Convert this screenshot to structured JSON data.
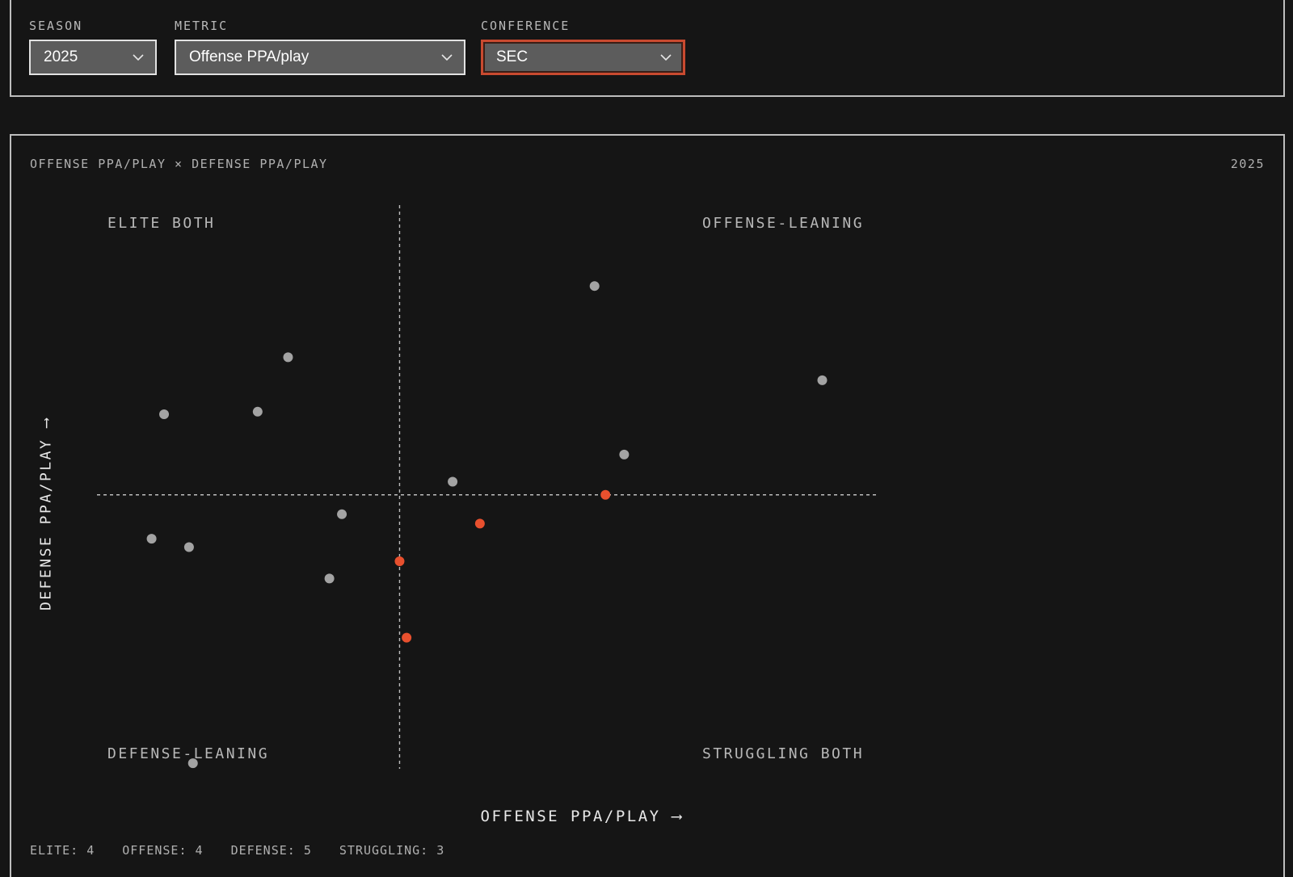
{
  "filters": {
    "season": {
      "label": "SEASON",
      "value": "2025"
    },
    "metric": {
      "label": "METRIC",
      "value": "Offense PPA/play"
    },
    "conference": {
      "label": "CONFERENCE",
      "value": "SEC"
    }
  },
  "chart": {
    "title": "OFFENSE PPA/PLAY × DEFENSE PPA/PLAY",
    "year": "2025",
    "quadrants": {
      "top_left": "ELITE BOTH",
      "top_right": "OFFENSE-LEANING",
      "bottom_left": "DEFENSE-LEANING",
      "bottom_right": "STRUGGLING BOTH"
    },
    "x_axis_label": "OFFENSE PPA/PLAY ⟶",
    "y_axis_label": "DEFENSE PPA/PLAY ⟶",
    "counts": {
      "elite": "ELITE: 4",
      "offense": "OFFENSE: 4",
      "defense": "DEFENSE: 5",
      "struggling": "STRUGGLING: 3"
    }
  },
  "chart_data": {
    "type": "scatter",
    "title": "OFFENSE PPA/PLAY × DEFENSE PPA/PLAY",
    "xlabel": "OFFENSE PPA/PLAY",
    "ylabel": "DEFENSE PPA/PLAY",
    "xlim": [
      0,
      1
    ],
    "ylim": [
      0,
      1
    ],
    "grid": false,
    "colors": {
      "default": "#a3a3a3",
      "highlight": "#e8502e",
      "guide": "#bdbdbd"
    },
    "reference_lines": {
      "x": 0.387,
      "y": 0.522
    },
    "points": [
      {
        "x": 0.637,
        "y": 0.921,
        "highlight": false
      },
      {
        "x": 0.244,
        "y": 0.785,
        "highlight": false
      },
      {
        "x": 0.929,
        "y": 0.741,
        "highlight": false
      },
      {
        "x": 0.085,
        "y": 0.676,
        "highlight": false
      },
      {
        "x": 0.205,
        "y": 0.681,
        "highlight": false
      },
      {
        "x": 0.675,
        "y": 0.599,
        "highlight": false
      },
      {
        "x": 0.455,
        "y": 0.547,
        "highlight": false
      },
      {
        "x": 0.651,
        "y": 0.522,
        "highlight": true
      },
      {
        "x": 0.313,
        "y": 0.485,
        "highlight": false
      },
      {
        "x": 0.49,
        "y": 0.467,
        "highlight": true
      },
      {
        "x": 0.069,
        "y": 0.438,
        "highlight": false
      },
      {
        "x": 0.117,
        "y": 0.422,
        "highlight": false
      },
      {
        "x": 0.387,
        "y": 0.395,
        "highlight": true
      },
      {
        "x": 0.297,
        "y": 0.362,
        "highlight": false
      },
      {
        "x": 0.396,
        "y": 0.249,
        "highlight": true
      },
      {
        "x": 0.122,
        "y": 0.009,
        "highlight": false
      }
    ]
  }
}
